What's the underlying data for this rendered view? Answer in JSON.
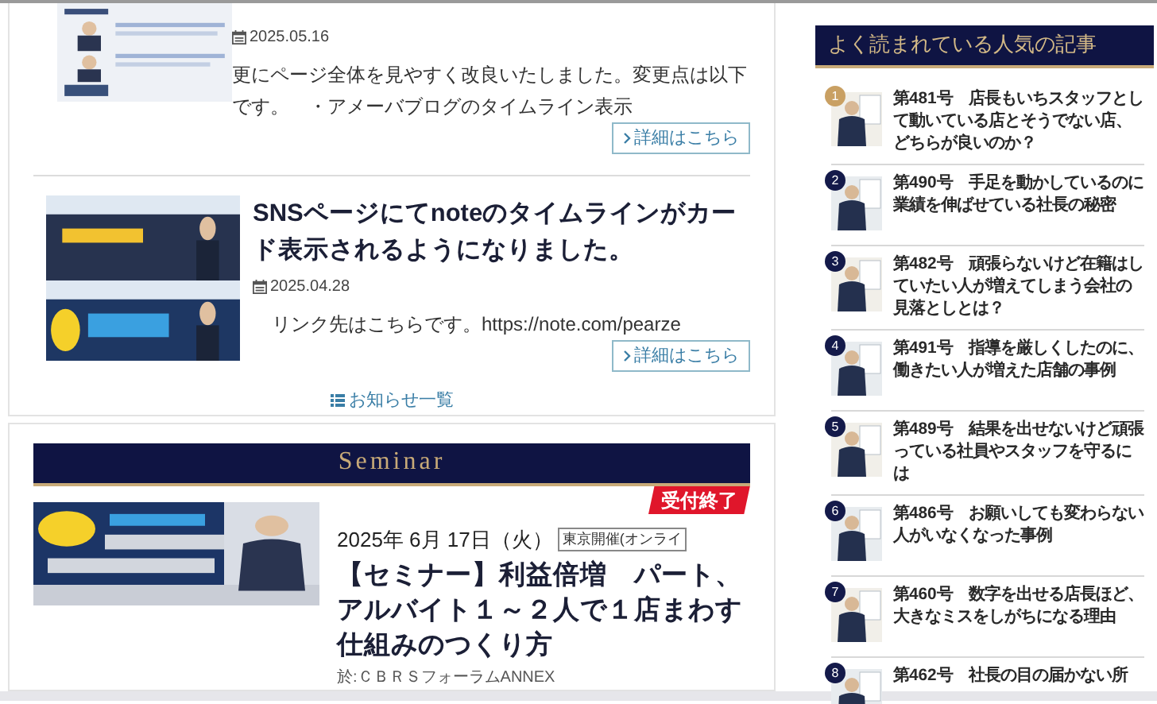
{
  "news": [
    {
      "date": "2025.05.16",
      "body": "更にページ全体を見やすく改良いたしました。変更点は以下です。　・アメーバブログのタイムライン表示",
      "button": "詳細はこちら"
    },
    {
      "title": "SNSページにてnoteのタイムラインがカード表示されるようになりました。",
      "date": "2025.04.28",
      "body": "リンク先はこちらです。https://note.com/pearze",
      "button": "詳細はこちら"
    }
  ],
  "news_list_link": "お知らせ一覧",
  "seminar": {
    "heading": "Seminar",
    "items": [
      {
        "date": "2025年 6月 17日（火）",
        "place_tag": "東京開催(オンライ",
        "status": "受付終了",
        "title": "【セミナー】利益倍増　パート、アルバイト１～２人で１店まわす仕組みのつくり方",
        "venue": "於:ＣＢＲＳフォーラムANNEX"
      }
    ]
  },
  "popular": {
    "heading": "よく読まれている人気の記事",
    "items": [
      {
        "rank": "1",
        "color": "#c9a063",
        "title": "第481号　店長もいちスタッフとして動いている店とそうでない店、どちらが良いのか？"
      },
      {
        "rank": "2",
        "color": "#141a4a",
        "title": "第490号　手足を動かしているのに業績を伸ばせている社長の秘密"
      },
      {
        "rank": "3",
        "color": "#141a4a",
        "title": "第482号　頑張らないけど在籍はしていたい人が増えてしまう会社の見落としとは？"
      },
      {
        "rank": "4",
        "color": "#141a4a",
        "title": "第491号　指導を厳しくしたのに、働きたい人が増えた店舗の事例"
      },
      {
        "rank": "5",
        "color": "#141a4a",
        "title": "第489号　結果を出せないけど頑張っている社員やスタッフを守るには"
      },
      {
        "rank": "6",
        "color": "#141a4a",
        "title": "第486号　お願いしても変わらない人がいなくなった事例"
      },
      {
        "rank": "7",
        "color": "#141a4a",
        "title": "第460号　数字を出せる店長ほど、大きなミスをしがちになる理由"
      },
      {
        "rank": "8",
        "color": "#141a4a",
        "title": "第462号　社長の目の届かない所"
      }
    ]
  }
}
